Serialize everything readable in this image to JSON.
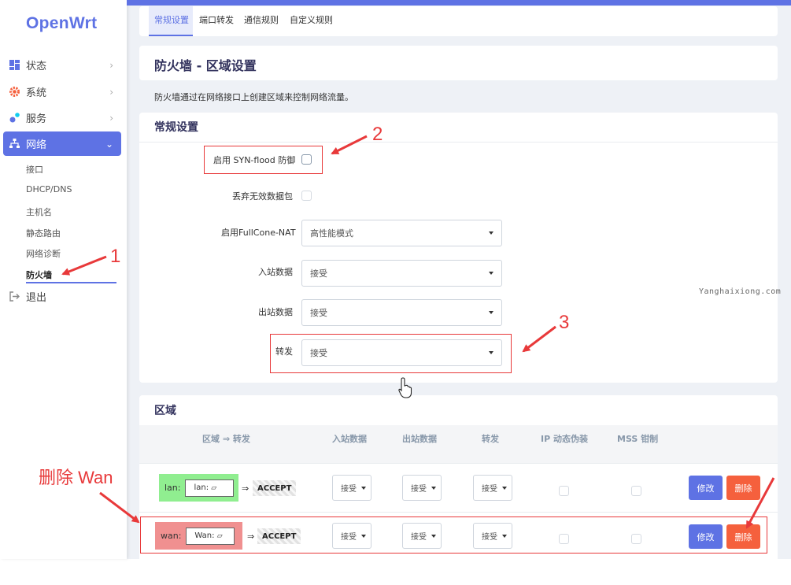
{
  "brand": {
    "logo": "OpenWrt",
    "accent": "#5e72e4"
  },
  "sidebar": {
    "items": [
      {
        "label": "状态",
        "icon": "dashboard-icon"
      },
      {
        "label": "系统",
        "icon": "gear-icon"
      },
      {
        "label": "服务",
        "icon": "cogs-icon"
      },
      {
        "label": "网络",
        "icon": "sitemap-icon",
        "active": true
      }
    ],
    "subitems": [
      "接口",
      "DHCP/DNS",
      "主机名",
      "静态路由",
      "网络诊断",
      "防火墙"
    ],
    "logout": "退出"
  },
  "tabs": [
    "常规设置",
    "端口转发",
    "通信规则",
    "自定义规则"
  ],
  "page": {
    "title": "防火墙 - 区域设置",
    "description": "防火墙通过在网络接口上创建区域来控制网络流量。"
  },
  "general": {
    "section_title": "常规设置",
    "syn_flood_label": "启用 SYN-flood 防御",
    "drop_invalid_label": "丢弃无效数据包",
    "fullcone_label": "启用FullCone-NAT",
    "fullcone_value": "高性能模式",
    "input_label": "入站数据",
    "input_value": "接受",
    "output_label": "出站数据",
    "output_value": "接受",
    "forward_label": "转发",
    "forward_value": "接受"
  },
  "zones": {
    "section_title": "区域",
    "columns": [
      "区域 ⇒ 转发",
      "入站数据",
      "出站数据",
      "转发",
      "IP 动态伪装",
      "MSS 钳制"
    ],
    "rows": [
      {
        "name": "lan:",
        "inner": "lan:",
        "arrow": "⇒",
        "target": "ACCEPT",
        "input": "接受",
        "output": "接受",
        "forward": "接受",
        "edit": "修改",
        "delete": "删除",
        "color": "#90ee90"
      },
      {
        "name": "wan:",
        "inner": "Wan:",
        "arrow": "⇒",
        "target": "ACCEPT",
        "input": "接受",
        "output": "接受",
        "forward": "接受",
        "edit": "修改",
        "delete": "删除",
        "color": "#f09090"
      }
    ]
  },
  "annotations": {
    "n1": "1",
    "n2": "2",
    "n3": "3",
    "delete_wan": "删除 Wan",
    "color": "#e8393a"
  },
  "watermark": "Yanghaixiong.com"
}
